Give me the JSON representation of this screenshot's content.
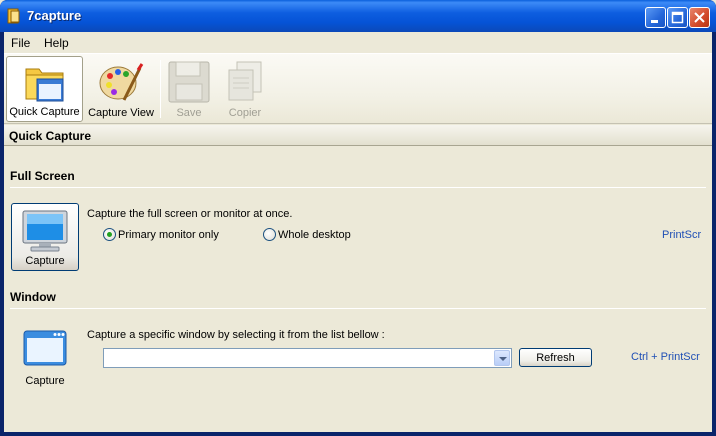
{
  "window": {
    "title": "7capture"
  },
  "menu": [
    "File",
    "Help"
  ],
  "toolbar": {
    "quick_capture": "Quick Capture",
    "capture_view": "Capture View",
    "save": "Save",
    "copier": "Copier"
  },
  "section_title": "Quick Capture",
  "full_screen": {
    "title": "Full Screen",
    "description": "Capture the full screen or monitor at once.",
    "capture_label": "Capture",
    "options": [
      "Primary monitor only",
      "Whole desktop"
    ],
    "selected": "Primary monitor only",
    "shortcut": "PrintScr"
  },
  "window_capture": {
    "title": "Window",
    "description": "Capture a specific window by selecting it from the list bellow :",
    "capture_label": "Capture",
    "dropdown_value": "",
    "refresh_label": "Refresh",
    "shortcut": "Ctrl + PrintScr"
  },
  "colors": {
    "titlebar": "#0553d6",
    "link": "#1f4fb5",
    "radio_selected": "#21a121"
  }
}
